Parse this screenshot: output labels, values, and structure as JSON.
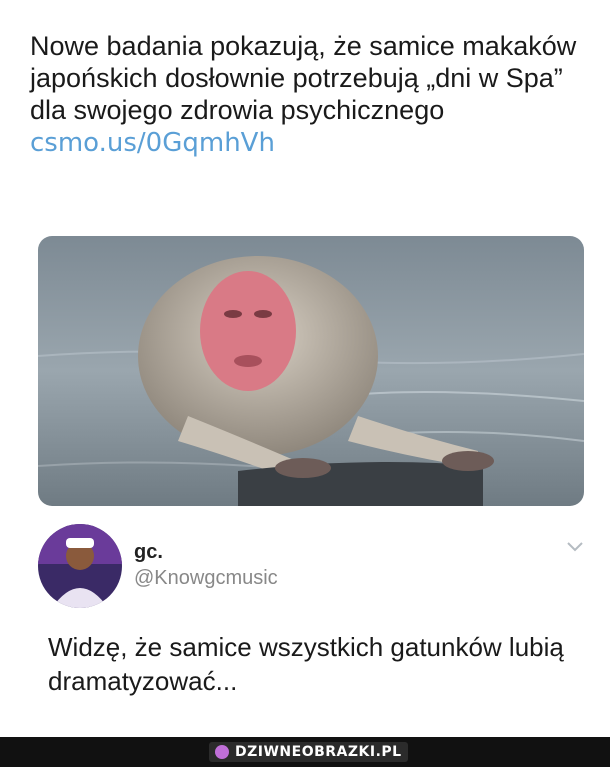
{
  "post": {
    "text": "Nowe badania pokazują, że samice makaków japońskich dosłownie potrzebują „dni w Spa” dla swojego zdrowia psychicznego",
    "link": "csmo.us/0GqmhVh"
  },
  "reply": {
    "name": "gc.",
    "handle": "@Knowgcmusic",
    "text": "Widzę, że samice wszystkich gatunków lubią dramatyzować..."
  },
  "footer": {
    "brand": "DZIWNEOBRAZKI.PL"
  },
  "icons": {
    "chevron": "chevron-down-icon",
    "brand": "brand-logo-icon"
  },
  "colors": {
    "link": "#5a9fd6",
    "footer_bg": "#111111"
  }
}
